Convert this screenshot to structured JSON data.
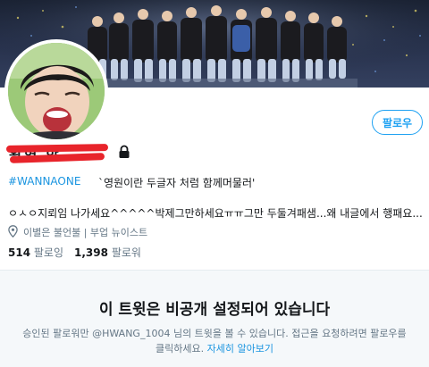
{
  "profile": {
    "display_name": "황현 한",
    "follow_label": "팔로우",
    "bio_hashtag": "#WANNAONE",
    "bio_quote": "`영원이란 두글자 처럼 함께머물러'",
    "bio_line2": "ㅇㅅㅇ지뢰임 나가세요^^^^^박제그만하세요ㅠㅠ그만 두둘겨패샘...왜 내글에서 행패요...",
    "location": "이별은 불언불 | 부업 뉴이스트",
    "stats": {
      "following_count": "514",
      "following_label": "팔로잉",
      "followers_count": "1,398",
      "followers_label": "팔로워"
    }
  },
  "protected_notice": {
    "title": "이 트윗은 비공개 설정되어 있습니다",
    "description": "승인된 팔로워만 @HWANG_1004 님의 트윗을 볼 수 있습니다. 접근을 요청하려면 팔로우를 클릭하세요.",
    "learn_more": "자세히 알아보기"
  },
  "icons": {
    "lock": "lock-icon",
    "location": "location-pin-icon"
  },
  "colors": {
    "accent": "#1da1f2",
    "link": "#1b95e0",
    "redaction": "#e8242b",
    "muted": "#657786"
  }
}
